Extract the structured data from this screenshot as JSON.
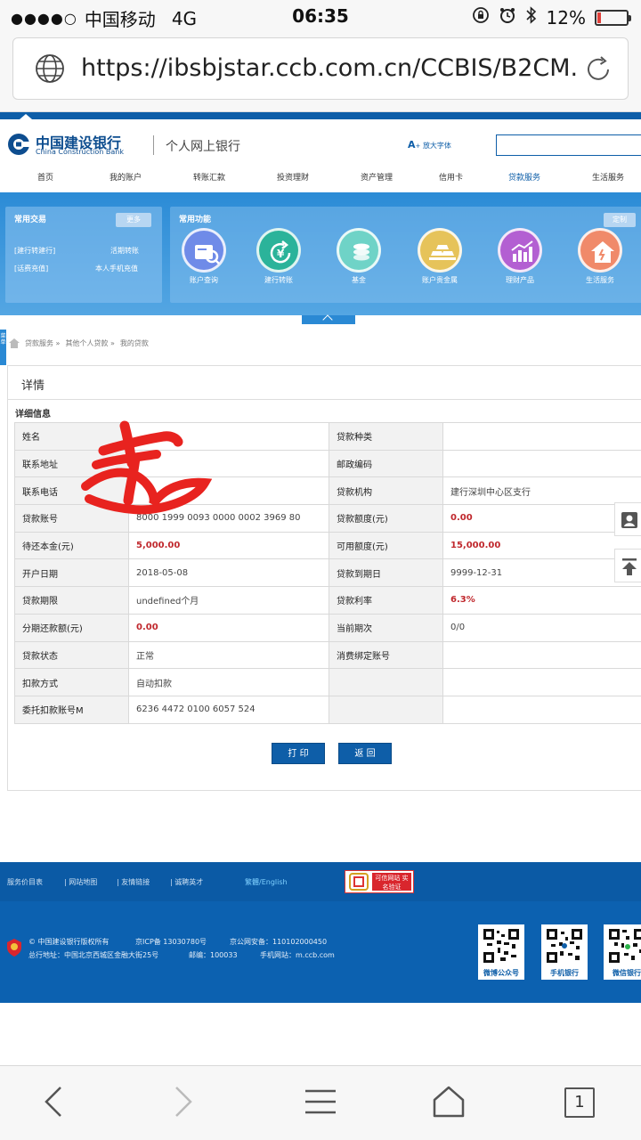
{
  "status": {
    "carrier": "中国移动",
    "network": "4G",
    "time": "06:35",
    "battery": "12%",
    "battery_level": 0.12,
    "signal_dots": "●●●●○"
  },
  "browser": {
    "url": "https://ibsbjstar.ccb.com.cn/CCBIS/B2CM...",
    "tab_count": "1"
  },
  "header": {
    "brand_cn": "中国建设银行",
    "brand_en": "China Construction Bank",
    "product": "个人网上银行",
    "font_size_label": "放大字体",
    "search_placeholder": ""
  },
  "nav": {
    "items": [
      "首页",
      "我的账户",
      "转账汇款",
      "投资理财",
      "资产管理",
      "信用卡",
      "贷款服务",
      "生活服务"
    ],
    "active": "贷款服务"
  },
  "quick": {
    "title": "常用交易",
    "more": "更多",
    "links": [
      "[建行转建行]",
      "活期转账",
      "[话费充值]",
      "本人手机充值"
    ]
  },
  "functions": {
    "title": "常用功能",
    "custom": "定制",
    "items": [
      {
        "label": "账户查询",
        "color": "#6f8be8",
        "icon": "account-query-icon"
      },
      {
        "label": "建行转账",
        "color": "#2bb39a",
        "icon": "transfer-icon"
      },
      {
        "label": "基金",
        "color": "#6fd3c7",
        "icon": "fund-icon"
      },
      {
        "label": "账户贵金属",
        "color": "#e6c35a",
        "icon": "gold-icon"
      },
      {
        "label": "理财产品",
        "color": "#b35fd2",
        "icon": "wealth-icon"
      },
      {
        "label": "生活服务",
        "color": "#f08a6a",
        "icon": "life-service-icon"
      }
    ]
  },
  "sidetab": "菜单",
  "breadcrumb": [
    "贷款服务",
    "其他个人贷款",
    "我的贷款"
  ],
  "card": {
    "title": "详情",
    "subtitle": "详细信息"
  },
  "detail": {
    "rows": [
      {
        "l1": "姓名",
        "v1": "",
        "v1_red": false,
        "l2": "贷款种类",
        "v2": "",
        "v2_red": false
      },
      {
        "l1": "联系地址",
        "v1": "",
        "v1_red": false,
        "l2": "邮政编码",
        "v2": "",
        "v2_red": false
      },
      {
        "l1": "联系电话",
        "v1": "",
        "v1_red": false,
        "l2": "贷款机构",
        "v2": "建行深圳中心区支行",
        "v2_red": false
      },
      {
        "l1": "贷款账号",
        "v1": "8000 1999 0093 0000 0002 3969 80",
        "v1_red": false,
        "l2": "贷款额度(元)",
        "v2": "0.00",
        "v2_red": true
      },
      {
        "l1": "待还本金(元)",
        "v1": "5,000.00",
        "v1_red": true,
        "l2": "可用额度(元)",
        "v2": "15,000.00",
        "v2_red": true
      },
      {
        "l1": "开户日期",
        "v1": "2018-05-08",
        "v1_red": false,
        "l2": "贷款到期日",
        "v2": "9999-12-31",
        "v2_red": false
      },
      {
        "l1": "贷款期限",
        "v1": "undefined个月",
        "v1_red": false,
        "l2": "贷款利率",
        "v2": "6.3%",
        "v2_red": true
      },
      {
        "l1": "分期还款额(元)",
        "v1": "0.00",
        "v1_red": true,
        "l2": "当前期次",
        "v2": "0/0",
        "v2_red": false
      },
      {
        "l1": "贷款状态",
        "v1": "正常",
        "v1_red": false,
        "l2": "消费绑定账号",
        "v2": "",
        "v2_red": false
      },
      {
        "l1": "扣款方式",
        "v1": "自动扣款",
        "v1_red": false,
        "l2": "",
        "v2": "",
        "v2_red": false
      },
      {
        "l1": "委托扣款账号M",
        "v1": "6236 4472 0100 6057 524",
        "v1_red": false,
        "l2": "",
        "v2": "",
        "v2_red": false
      }
    ]
  },
  "buttons": {
    "print": "打 印",
    "back": "返 回"
  },
  "footer": {
    "links": [
      "服务价目表",
      "| 网站地图",
      "| 友情链接",
      "| 诚聘英才"
    ],
    "lang": "繁體/English",
    "badge": "可信网站 实名验证",
    "copyright": "© 中国建设银行版权所有",
    "icp": "京ICP备 13030780号",
    "police": "京公网安备：110102000450",
    "address": "总行地址：中国北京西城区金融大街25号",
    "postcode": "邮编：100033",
    "mobile_site": "手机网站：m.ccb.com",
    "qrs": [
      "微博公众号",
      "手机银行",
      "微信银行"
    ]
  }
}
